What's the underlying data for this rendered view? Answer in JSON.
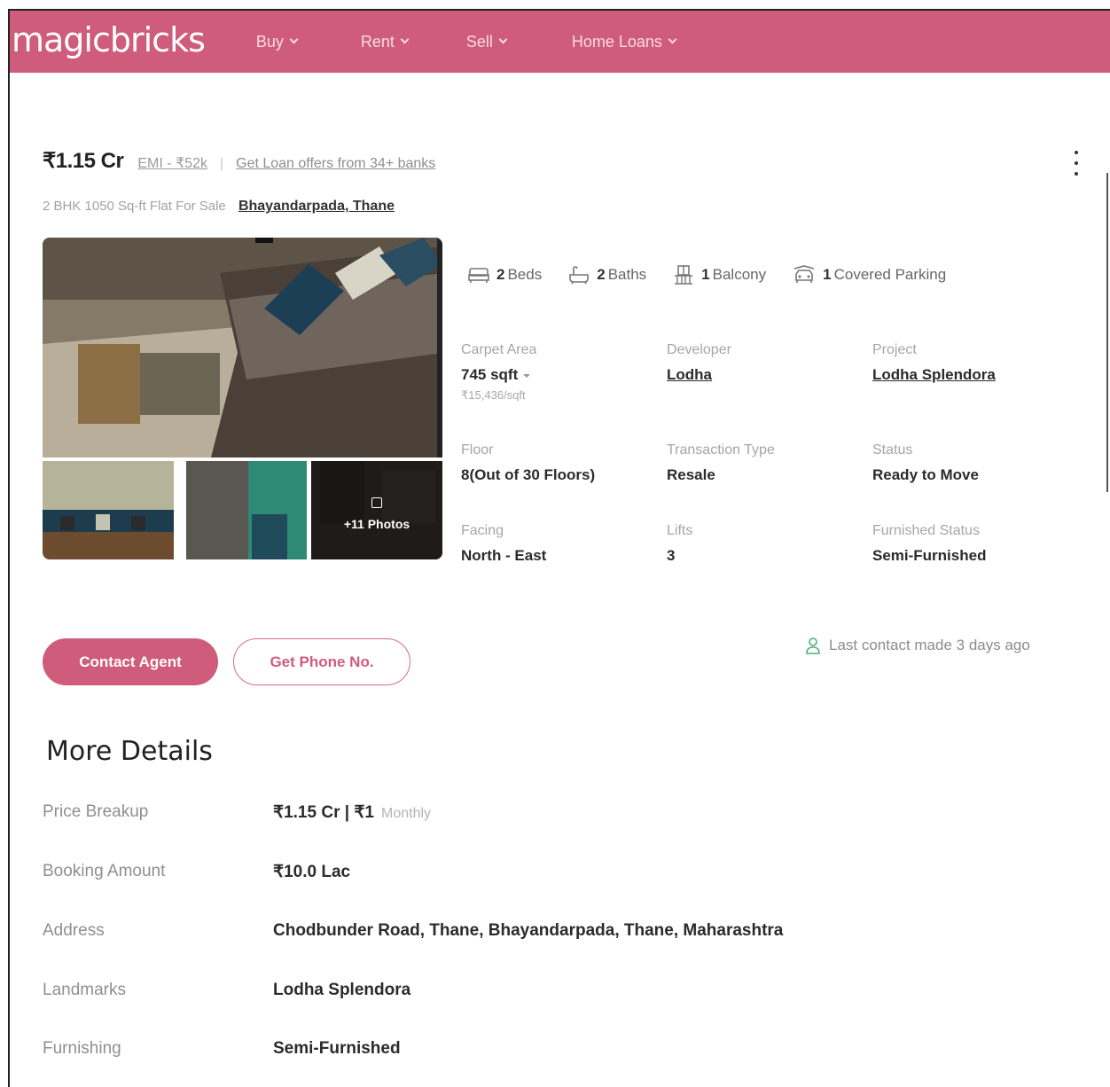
{
  "header": {
    "logo": "magicbricks",
    "nav": [
      {
        "label": "Buy"
      },
      {
        "label": "Rent"
      },
      {
        "label": "Sell"
      },
      {
        "label": "Home Loans"
      }
    ],
    "brand_color": "#cf5c7b"
  },
  "listing": {
    "price": "₹1.15 Cr",
    "emi": "EMI - ₹52k",
    "separator": "|",
    "loan_offer": "Get Loan offers from 34+ banks",
    "subtitle": "2 BHK 1050 Sq-ft Flat For Sale",
    "location": "Bhayandarpada, Thane"
  },
  "gallery": {
    "more_photos": "+11 Photos"
  },
  "amenities": [
    {
      "count": "2",
      "label": "Beds",
      "icon": "bed-icon"
    },
    {
      "count": "2",
      "label": "Baths",
      "icon": "bath-icon"
    },
    {
      "count": "1",
      "label": "Balcony",
      "icon": "balcony-icon"
    },
    {
      "count": "1",
      "label": "Covered Parking",
      "icon": "car-icon"
    }
  ],
  "specs": {
    "carpet_area": {
      "label": "Carpet Area",
      "value": "745 sqft",
      "sub": "₹15,436/sqft"
    },
    "developer": {
      "label": "Developer",
      "value": "Lodha"
    },
    "project": {
      "label": "Project",
      "value": "Lodha Splendora"
    },
    "floor": {
      "label": "Floor",
      "value": "8(Out of 30 Floors)"
    },
    "transaction": {
      "label": "Transaction Type",
      "value": "Resale"
    },
    "status": {
      "label": "Status",
      "value": "Ready to Move"
    },
    "facing": {
      "label": "Facing",
      "value": "North - East"
    },
    "lifts": {
      "label": "Lifts",
      "value": "3"
    },
    "furnished": {
      "label": "Furnished Status",
      "value": "Semi-Furnished"
    }
  },
  "actions": {
    "contact_agent": "Contact Agent",
    "get_phone": "Get Phone No.",
    "last_contact": "Last contact made 3 days ago"
  },
  "more_details": {
    "title": "More Details",
    "price_breakup": {
      "label": "Price Breakup",
      "value": "₹1.15 Cr | ₹1",
      "suffix": "Monthly"
    },
    "booking_amount": {
      "label": "Booking Amount",
      "value": "₹10.0 Lac"
    },
    "address": {
      "label": "Address",
      "value": "Chodbunder Road, Thane, Bhayandarpada, Thane, Maharashtra"
    },
    "landmarks": {
      "label": "Landmarks",
      "value": "Lodha Splendora"
    },
    "furnishing": {
      "label": "Furnishing",
      "value": "Semi-Furnished"
    }
  }
}
